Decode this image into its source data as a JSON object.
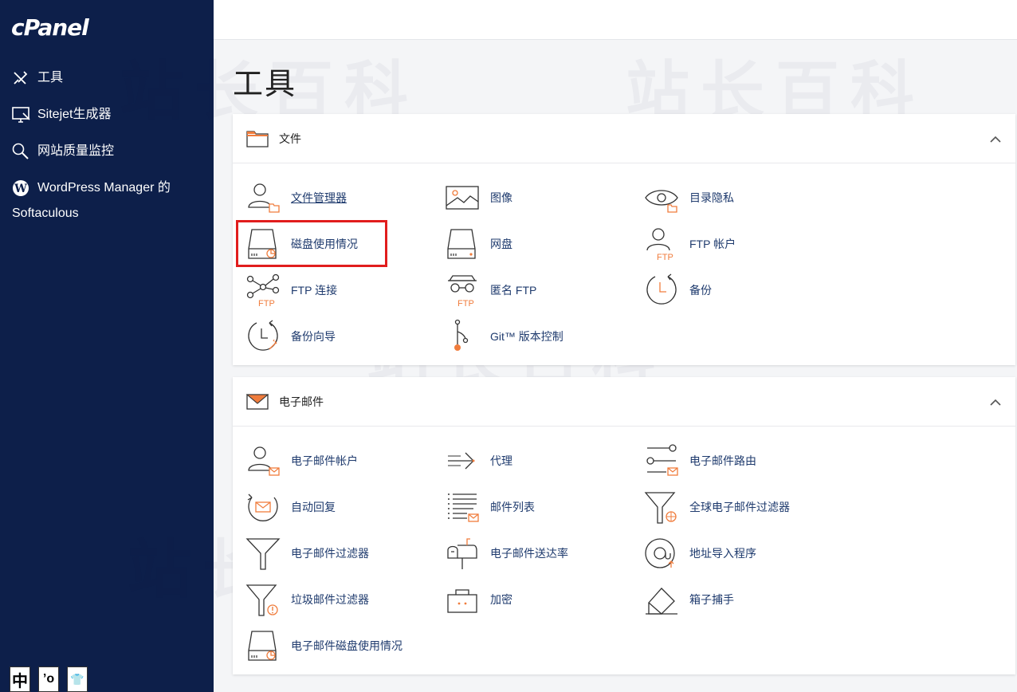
{
  "brand": {
    "logo_text": "cPanel"
  },
  "sidebar": {
    "items": [
      {
        "label": "工具",
        "icon": "tools-icon"
      },
      {
        "label": "Sitejet生成器",
        "icon": "monitor-icon"
      },
      {
        "label": "网站质量监控",
        "icon": "magnifier-icon"
      },
      {
        "label": "WordPress Manager 的",
        "label2": "Softaculous",
        "icon": "wordpress-icon"
      }
    ]
  },
  "language_bar": [
    "中",
    "’o",
    "👕"
  ],
  "page": {
    "title": "工具"
  },
  "watermark": "站长百科",
  "sections": {
    "files": {
      "title": "文件",
      "tools": [
        {
          "label": "文件管理器"
        },
        {
          "label": "图像"
        },
        {
          "label": "目录隐私"
        },
        {
          "label": "磁盘使用情况"
        },
        {
          "label": "网盘"
        },
        {
          "label": "FTP 帐户"
        },
        {
          "label": "FTP 连接"
        },
        {
          "label": "匿名 FTP"
        },
        {
          "label": "备份"
        },
        {
          "label": "备份向导"
        },
        {
          "label": "Git™ 版本控制"
        }
      ]
    },
    "email": {
      "title": "电子邮件",
      "tools": [
        {
          "label": "电子邮件帐户"
        },
        {
          "label": "代理"
        },
        {
          "label": "电子邮件路由"
        },
        {
          "label": "自动回复"
        },
        {
          "label": "邮件列表"
        },
        {
          "label": "全球电子邮件过滤器"
        },
        {
          "label": "电子邮件过滤器"
        },
        {
          "label": "电子邮件送达率"
        },
        {
          "label": "地址导入程序"
        },
        {
          "label": "垃圾邮件过滤器"
        },
        {
          "label": "加密"
        },
        {
          "label": "箱子捕手"
        },
        {
          "label": "电子邮件磁盘使用情况"
        }
      ]
    }
  },
  "icon_text": {
    "ftp": "FTP"
  },
  "colors": {
    "sidebar": "#0d1f4a",
    "accent": "#f07c3c",
    "link": "#1f3b6e",
    "highlight": "#e11d1d"
  }
}
